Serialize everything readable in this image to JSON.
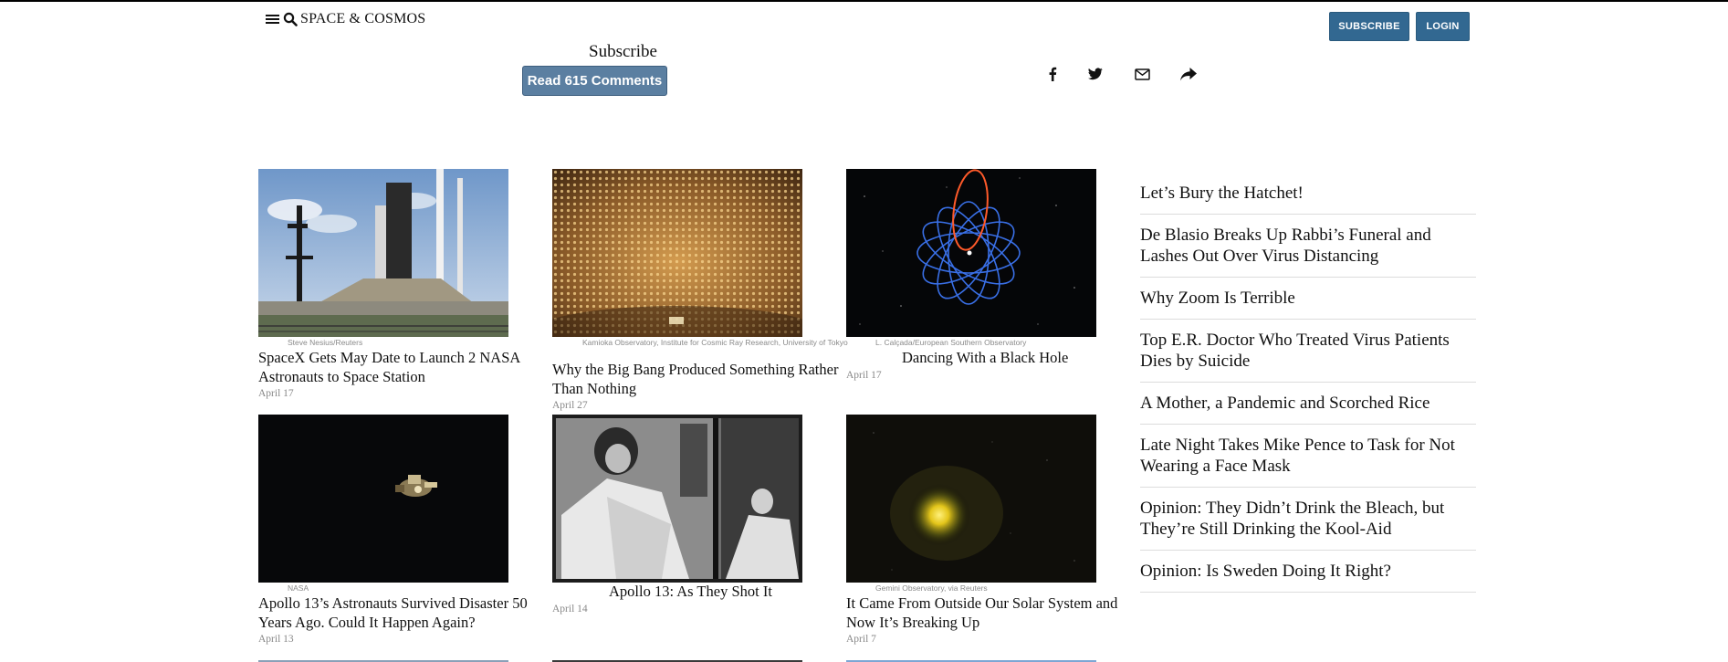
{
  "header": {
    "section_title": "SPACE & COSMOS",
    "subscribe_label": "SUBSCRIBE",
    "login_label": "LOGIN"
  },
  "article_tools": {
    "subscribe_text": "Subscribe",
    "comments_label": "Read 615 Comments",
    "share_icons": [
      "facebook-icon",
      "twitter-icon",
      "email-icon",
      "share-icon"
    ]
  },
  "stories": [
    {
      "credit": "Steve Nesius/Reuters",
      "headline": "SpaceX Gets May Date to Launch 2 NASA Astronauts to Space Station",
      "date": "April 17"
    },
    {
      "credit": "Kamioka Observatory, Institute for Cosmic Ray Research, University of Tokyo",
      "headline": "Why the Big Bang Produced Something Rather Than Nothing",
      "date": "April 27"
    },
    {
      "credit": "L. Calçada/European Southern Observatory",
      "headline": "Dancing With a Black Hole",
      "date": "April 17"
    },
    {
      "credit": "NASA",
      "headline": "Apollo 13’s Astronauts Survived Disaster 50 Years Ago. Could It Happen Again?",
      "date": "April 13"
    },
    {
      "credit": "",
      "headline": "Apollo 13: As They Shot It",
      "date": "April 14"
    },
    {
      "credit": "Gemini Observatory, via Reuters",
      "headline": "It Came From Outside Our Solar System and Now It’s Breaking Up",
      "date": "April 7"
    }
  ],
  "sidebar": {
    "items": [
      "Let’s Bury the Hatchet!",
      "De Blasio Breaks Up Rabbi’s Funeral and Lashes Out Over Virus Distancing",
      "Why Zoom Is Terrible",
      "Top E.R. Doctor Who Treated Virus Patients Dies by Suicide",
      "A Mother, a Pandemic and Scorched Rice",
      "Late Night Takes Mike Pence to Task for Not Wearing a Face Mask",
      "Opinion: They Didn’t Drink the Bleach, but They’re Still Drinking the Kool-Aid",
      "Opinion: Is Sweden Doing It Right?"
    ]
  },
  "colors": {
    "button_blue": "#326891",
    "comments_blue": "#5b7fa1"
  }
}
